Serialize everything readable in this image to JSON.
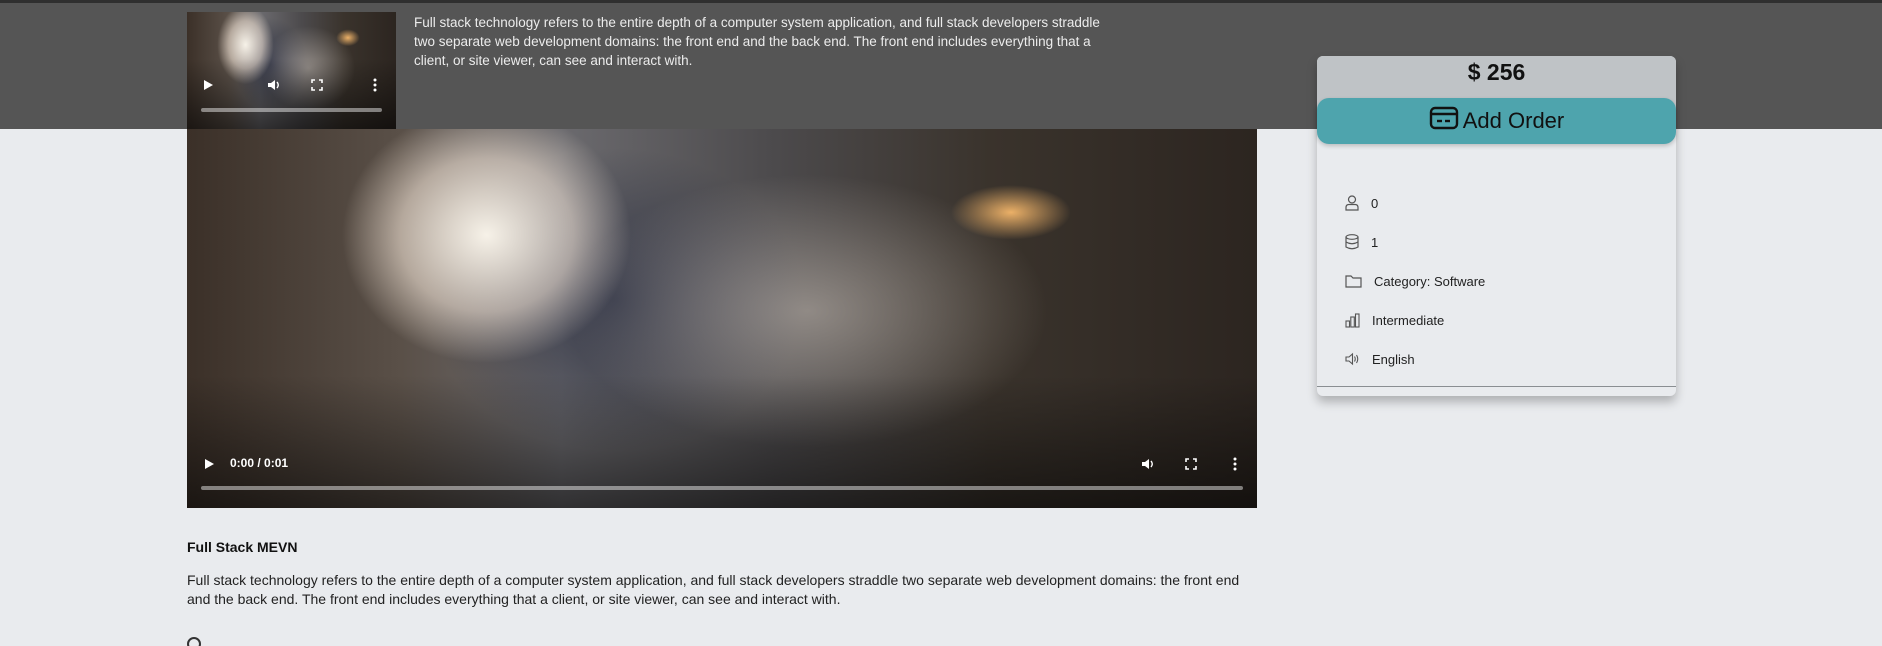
{
  "header": {
    "description": "Full stack technology refers to the entire depth of a computer system application, and full stack developers straddle two separate web development domains: the front end and the back end. The front end includes everything that a client, or site viewer, can see and interact with."
  },
  "main_video": {
    "time": "0:00 / 0:01"
  },
  "pricing": {
    "price": "$ 256",
    "add_order_label": "Add Order",
    "info": [
      {
        "icon": "user-icon",
        "value": "0"
      },
      {
        "icon": "database-icon",
        "value": "1"
      },
      {
        "icon": "folder-icon",
        "value": "Category: Software"
      },
      {
        "icon": "bar-chart-icon",
        "value": "Intermediate"
      },
      {
        "icon": "speaker-icon",
        "value": "English"
      }
    ]
  },
  "course": {
    "title": "Full Stack MEVN",
    "description": "Full stack technology refers to the entire depth of a computer system application, and full stack developers straddle two separate web development domains: the front end and the back end. The front end includes everything that a client, or site viewer, can see and interact with."
  },
  "colors": {
    "accent": "#4ea4ad",
    "header_band": "#555555",
    "page_bg": "#e9ebee"
  }
}
